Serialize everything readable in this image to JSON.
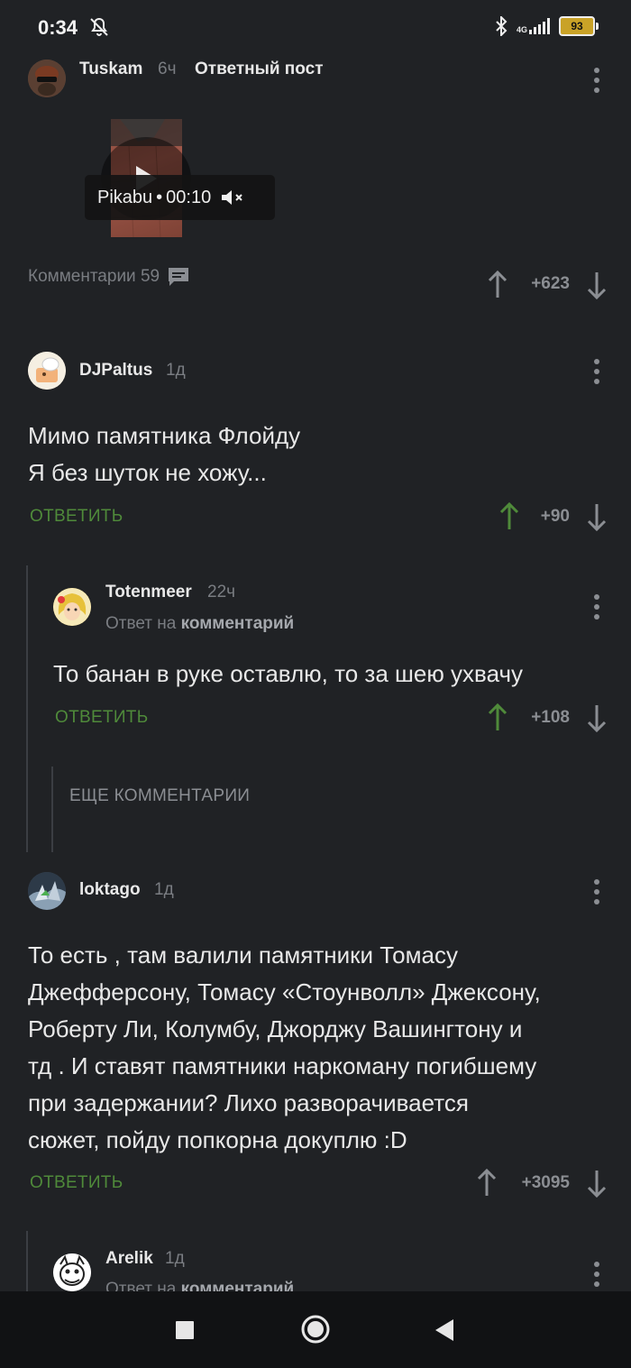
{
  "status_bar": {
    "time": "0:34",
    "network": "4G",
    "battery": "93"
  },
  "post": {
    "author": "Tuskam",
    "time": "6ч",
    "badge": "Ответный пост",
    "video": {
      "source": "Pikabu",
      "duration": "00:10"
    },
    "comments_label": "Комментарии 59",
    "score": "+623"
  },
  "comments": [
    {
      "author": "DJPaltus",
      "time": "1д",
      "text_lines": [
        "Мимо памятника Флойду",
        "Я без шуток не хожу..."
      ],
      "reply_label": "ОТВЕТИТЬ",
      "score": "+90"
    },
    {
      "author": "Totenmeer",
      "time": "22ч",
      "reply_to_prefix": "Ответ на",
      "reply_to_target": "комментарий",
      "text": "То банан в руке оставлю, то за шею ухвачу",
      "reply_label": "ОТВЕТИТЬ",
      "score": "+108"
    },
    {
      "more_label": "ЕЩЕ КОММЕНТАРИИ"
    },
    {
      "author": "loktago",
      "time": "1д",
      "text_lines": [
        "То есть , там валили памятники Томасу",
        "Джефферсону, Томасу «Стоунволл» Джексону,",
        "Роберту Ли, Колумбу, Джорджу Вашингтону и",
        "тд . И ставят памятники наркоману погибшему",
        "при задержании? Лихо разворачивается",
        "сюжет, пойду попкорна докуплю :D"
      ],
      "reply_label": "ОТВЕТИТЬ",
      "score": "+3095"
    },
    {
      "author": "Arelik",
      "time": "1д",
      "reply_to_prefix": "Ответ на",
      "reply_to_target": "комментарий"
    }
  ],
  "colors": {
    "background": "#202225",
    "accent_green": "#4f8a3a",
    "muted": "#8b8e93"
  }
}
